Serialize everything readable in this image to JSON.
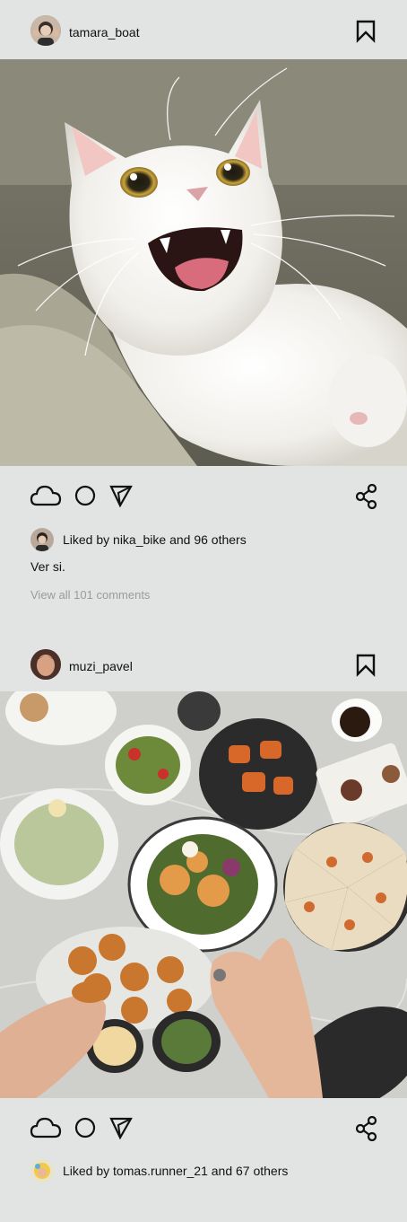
{
  "posts": [
    {
      "username": "tamara_boat",
      "photo_subject": "white cat meowing on sofa",
      "liked_by": "nika_bike",
      "likes_others": "Liked by nika_bike and 96 others",
      "caption": "Ver si.",
      "comments_link": "View all 101 comments"
    },
    {
      "username": "muzi_pavel",
      "photo_subject": "table of food plates with hand holding salad plate",
      "liked_by": "tomas.runner_21",
      "likes_others": "Liked by tomas.runner_21 and 67 others"
    }
  ],
  "icons": {
    "like": "cloud-icon",
    "comment": "circle-icon",
    "send": "send-triangle-icon",
    "share": "share-icon",
    "save": "bookmark-icon"
  },
  "colors": {
    "background": "#e2e4e3",
    "text": "#111111",
    "muted": "#9a9c9b"
  }
}
